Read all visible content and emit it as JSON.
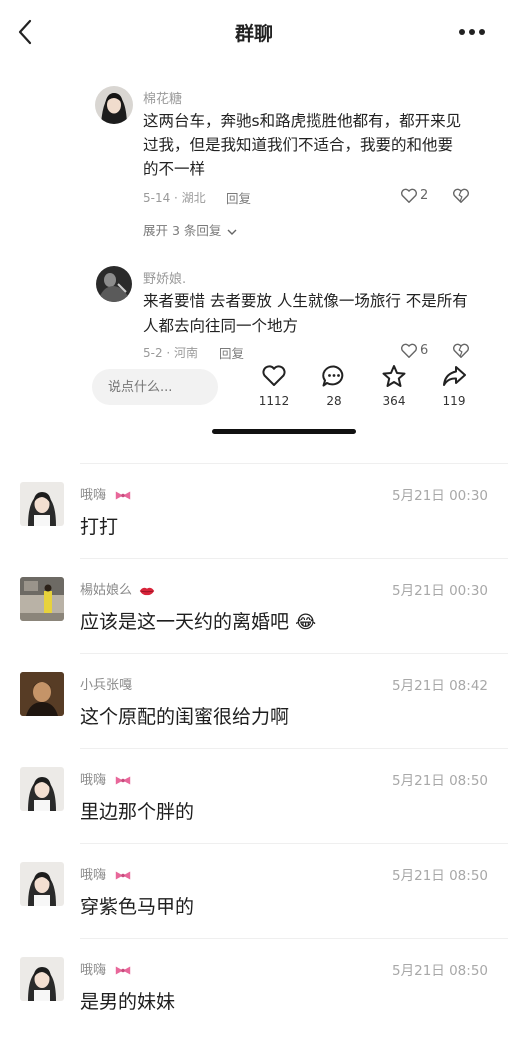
{
  "header": {
    "title": "群聊"
  },
  "panel": {
    "comments": [
      {
        "name": "棉花糖",
        "text_lines": [
          "这两台车，奔驰s和路虎揽胜他都有，都开来见",
          "过我，但是我知道我们不适合，我要的和他要",
          "的不一样"
        ],
        "meta": "5-14 · 湖北",
        "reply": "回复",
        "likes": "2",
        "expand": "展开 3 条回复"
      },
      {
        "name": "野娇娘.",
        "text_lines": [
          "来者要惜 去者要放 人生就像一场旅行 不是所有",
          "人都去向往同一个地方"
        ],
        "meta": "5-2 · 河南",
        "reply": "回复",
        "likes": "6"
      }
    ],
    "input_placeholder": "说点什么...",
    "actions": [
      {
        "icon": "heart-icon",
        "count": "1112"
      },
      {
        "icon": "comment-icon",
        "count": "28"
      },
      {
        "icon": "star-icon",
        "count": "364"
      },
      {
        "icon": "share-icon",
        "count": "119"
      }
    ]
  },
  "messages": [
    {
      "name": "哦嗨",
      "time": "5月21日 00:30",
      "text": "打打",
      "badge": "bow"
    },
    {
      "name": "楊姑娘么",
      "time": "5月21日 00:30",
      "text": "应该是这一天约的离婚吧",
      "badge": "lips",
      "emoji": "😂"
    },
    {
      "name": "小兵张嘎",
      "time": "5月21日 08:42",
      "text": "这个原配的闺蜜很给力啊"
    },
    {
      "name": "哦嗨",
      "time": "5月21日 08:50",
      "text": "里边那个胖的",
      "badge": "bow"
    },
    {
      "name": "哦嗨",
      "time": "5月21日 08:50",
      "text": "穿紫色马甲的",
      "badge": "bow"
    },
    {
      "name": "哦嗨",
      "time": "5月21日 08:50",
      "text": "是男的妹妹",
      "badge": "bow"
    }
  ],
  "colors": {
    "accent_pink": "#e8679a",
    "lips_red": "#d8243a",
    "text_gray": "#9a9a9a"
  }
}
